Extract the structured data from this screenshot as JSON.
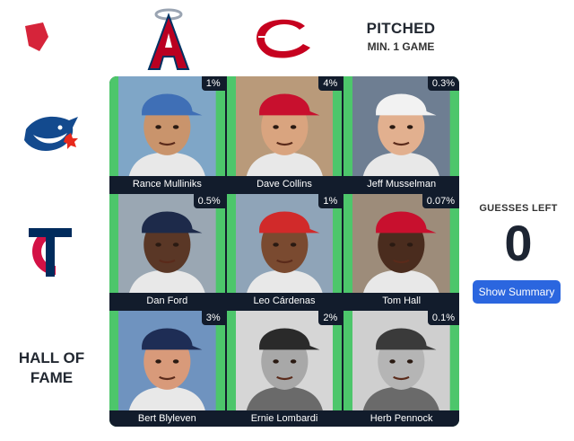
{
  "columns": [
    {
      "icon": "phillies-logo-icon"
    },
    {
      "icon": "angels-logo-icon"
    },
    {
      "icon": "reds-logo-icon"
    }
  ],
  "rows": [
    {
      "icon": "blue-jays-logo-icon"
    },
    {
      "icon": "twins-logo-icon"
    },
    {
      "label": "HALL OF FAME"
    }
  ],
  "category": {
    "title": "PITCHED",
    "subtitle": "MIN. 1 GAME"
  },
  "cells": [
    {
      "name": "Rance Mulliniks",
      "pct": "1%",
      "cap": "#3f6fb6",
      "skin": "#c9946c",
      "bg": "#7fa6c7",
      "bw": false
    },
    {
      "name": "Dave Collins",
      "pct": "4%",
      "cap": "#c8102e",
      "skin": "#d9a47f",
      "bg": "#b99a7a",
      "bw": false
    },
    {
      "name": "Jeff Musselman",
      "pct": "0.3%",
      "cap": "#f2f2f2",
      "skin": "#e2b08f",
      "bg": "#6e7e92",
      "bw": false
    },
    {
      "name": "Dan Ford",
      "pct": "0.5%",
      "cap": "#1d2a4a",
      "skin": "#5a3726",
      "bg": "#9aa7b3",
      "bw": false
    },
    {
      "name": "Leo Cárdenas",
      "pct": "1%",
      "cap": "#d12a2a",
      "skin": "#7a4a30",
      "bg": "#8fa4b8",
      "bw": false
    },
    {
      "name": "Tom Hall",
      "pct": "0.07%",
      "cap": "#c8102e",
      "skin": "#4a2c1e",
      "bg": "#9d8c7a",
      "bw": false
    },
    {
      "name": "Bert Blyleven",
      "pct": "3%",
      "cap": "#1e2d55",
      "skin": "#d89a7a",
      "bg": "#6f93bf",
      "bw": false
    },
    {
      "name": "Ernie Lombardi",
      "pct": "2%",
      "cap": "#2a2a2a",
      "skin": "#a8a8a8",
      "bg": "#d6d6d6",
      "bw": true
    },
    {
      "name": "Herb Pennock",
      "pct": "0.1%",
      "cap": "#3a3a3a",
      "skin": "#b5b5b5",
      "bg": "#cfcfcf",
      "bw": true
    }
  ],
  "guesses": {
    "label": "GUESSES LEFT",
    "count": "0"
  },
  "summary_button": "Show Summary",
  "colors": {
    "grid_bg": "#121c2c",
    "cell_green": "#4dc66b",
    "button_blue": "#2b66df"
  }
}
